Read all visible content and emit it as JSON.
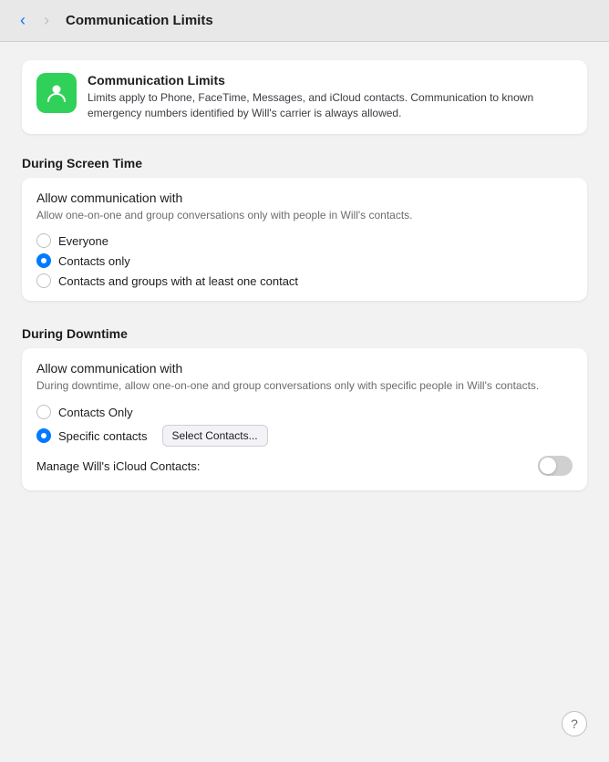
{
  "titleBar": {
    "title": "Communication Limits",
    "backEnabled": true,
    "forwardEnabled": false
  },
  "appCard": {
    "title": "Communication Limits",
    "description": "Limits apply to Phone, FaceTime, Messages, and iCloud contacts. Communication to known emergency numbers identified by Will's carrier is always allowed.",
    "iconAlt": "communication-limits-icon"
  },
  "screenTime": {
    "sectionHeading": "During Screen Time",
    "cardTitle": "Allow communication with",
    "cardDesc": "Allow one-on-one and group conversations only with people in Will's contacts.",
    "options": [
      {
        "label": "Everyone",
        "selected": false
      },
      {
        "label": "Contacts only",
        "selected": true
      },
      {
        "label": "Contacts and groups with at least one contact",
        "selected": false
      }
    ]
  },
  "downtime": {
    "sectionHeading": "During Downtime",
    "cardTitle": "Allow communication with",
    "cardDesc": "During downtime, allow one-on-one and group conversations only with specific people in Will's contacts.",
    "options": [
      {
        "label": "Contacts Only",
        "selected": false
      },
      {
        "label": "Specific contacts",
        "selected": true
      }
    ],
    "selectButtonLabel": "Select Contacts...",
    "manageLabel": "Manage Will's iCloud Contacts:",
    "toggleOn": false
  },
  "help": {
    "label": "?"
  }
}
